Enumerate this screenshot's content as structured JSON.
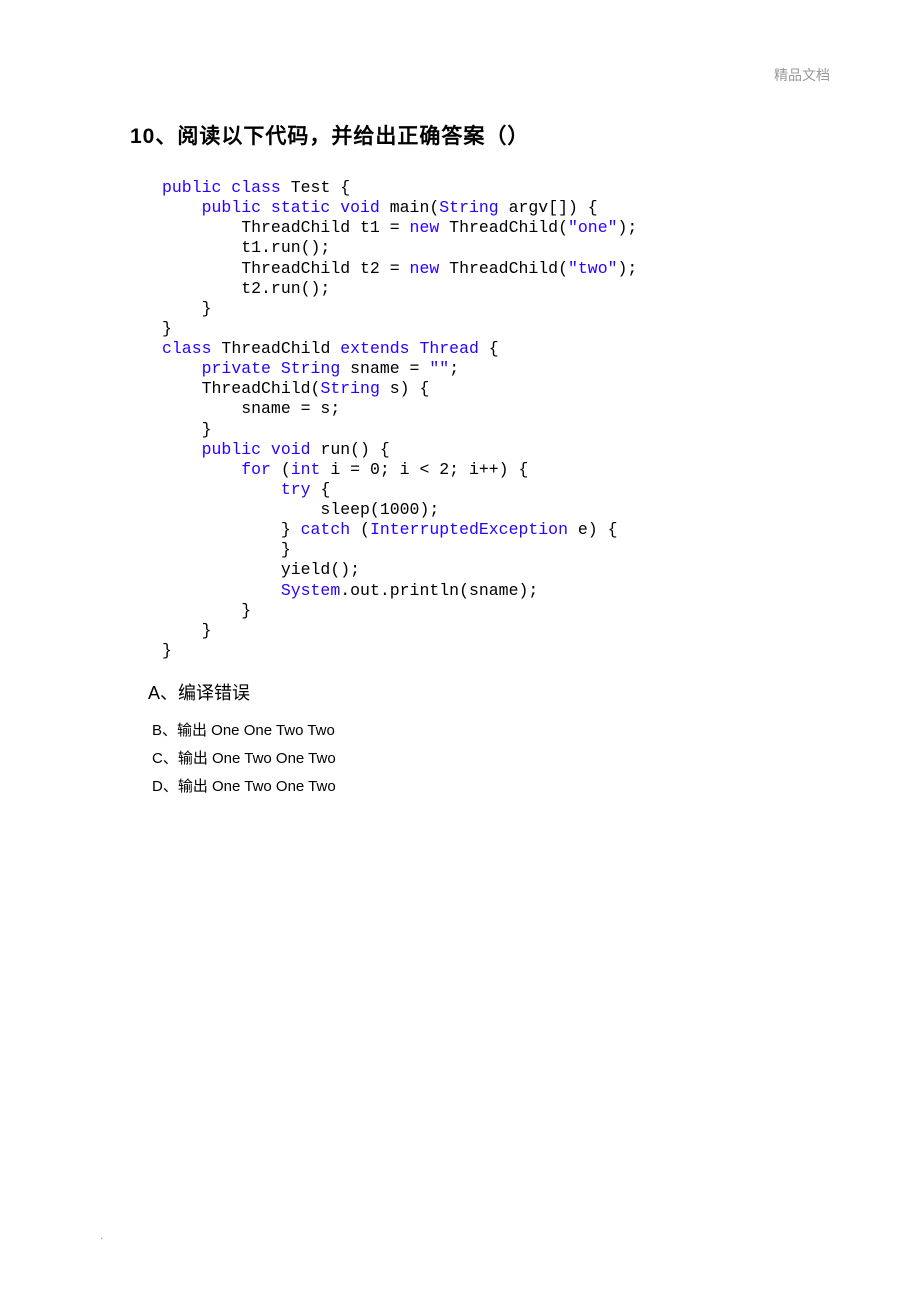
{
  "watermark": "精品文档",
  "title": "10、阅读以下代码，并给出正确答案（）",
  "code": {
    "l1_kw": "public class ",
    "l1_r": "Test {",
    "l2_pre": "    ",
    "l2_kw": "public static void ",
    "l2_r": "main(",
    "l2_str_kw": "String",
    "l2_r2": " argv[]) {",
    "l3_pre": "        ThreadChild t1 = ",
    "l3_kw": "new",
    "l3_mid": " ThreadChild(",
    "l3_str": "\"one\"",
    "l3_end": ");",
    "l4": "        t1.run();",
    "l5_pre": "        ThreadChild t2 = ",
    "l5_kw": "new",
    "l5_mid": " ThreadChild(",
    "l5_str": "\"two\"",
    "l5_end": ");",
    "l6": "        t2.run();",
    "l7": "    }",
    "l8": "}",
    "l9_kw": "class ",
    "l9_mid": "ThreadChild ",
    "l9_kw2": "extends ",
    "l9_cls": "Thread",
    "l9_end": " {",
    "l10_pre": "    ",
    "l10_kw": "private ",
    "l10_typ": "String",
    "l10_mid": " sname = ",
    "l10_str": "\"\"",
    "l10_end": ";",
    "l11_pre": "    ThreadChild(",
    "l11_typ": "String",
    "l11_end": " s) {",
    "l12": "        sname = s;",
    "l13": "    }",
    "l14_pre": "    ",
    "l14_kw": "public void ",
    "l14_r": "run() {",
    "l15_pre": "        ",
    "l15_kw": "for ",
    "l15_mid": "(",
    "l15_kw2": "int",
    "l15_end": " i = 0; i < 2; i++) {",
    "l16_pre": "            ",
    "l16_kw": "try",
    "l16_end": " {",
    "l17": "                sleep(1000);",
    "l18_pre": "            } ",
    "l18_kw": "catch ",
    "l18_mid": "(",
    "l18_typ": "InterruptedException",
    "l18_end": " e) {",
    "l19": "            }",
    "l20": "            yield();",
    "l21_pre": "            ",
    "l21_sys": "System",
    "l21_end": ".out.println(sname);",
    "l22": "        }",
    "l23": "    }",
    "l24": "}"
  },
  "answers": {
    "a": "A、编译错误",
    "b": "B、输出 One One Two Two",
    "c": "C、输出 One Two One Two",
    "d": "D、输出 One Two One Two"
  },
  "footer": "."
}
